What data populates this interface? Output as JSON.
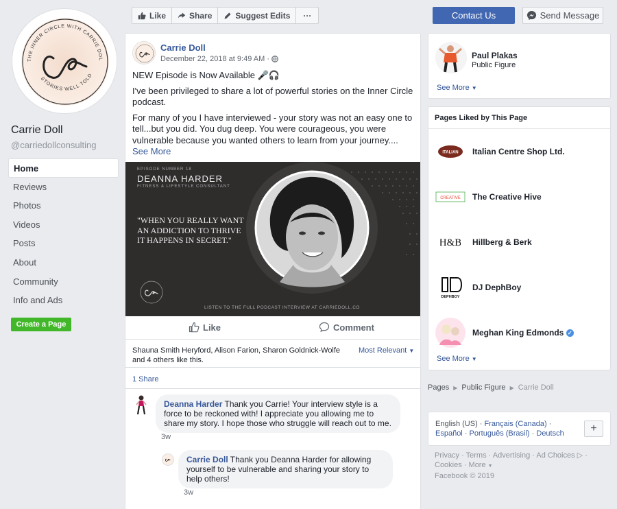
{
  "page": {
    "name": "Carrie Doll",
    "handle": "@carriedollconsulting",
    "logo_text": {
      "top_arc": "THE INNER CIRCLE WITH CARRIE DOLL",
      "bottom_arc": "STORIES WELL TOLD"
    }
  },
  "left_nav": {
    "items": [
      {
        "label": "Home",
        "active": true
      },
      {
        "label": "Reviews"
      },
      {
        "label": "Photos"
      },
      {
        "label": "Videos"
      },
      {
        "label": "Posts"
      },
      {
        "label": "About"
      },
      {
        "label": "Community"
      },
      {
        "label": "Info and Ads"
      }
    ],
    "create_page": "Create a Page"
  },
  "top_actions": {
    "like": "Like",
    "share": "Share",
    "suggest_edits": "Suggest Edits",
    "more": "···",
    "contact": "Contact Us",
    "send_message": "Send Message"
  },
  "post": {
    "author": "Carrie Doll",
    "date": "December 22, 2018 at 9:49 AM ·",
    "paragraphs": [
      "NEW Episode is Now Available 🎤🎧",
      "I've been privileged to share a lot of powerful stories on the Inner Circle podcast.",
      "For many of you I have interviewed - your story was not an easy one to tell...but you did. You dug deep. You were courageous, you were vulnerable because you wanted others to learn from your journey...."
    ],
    "see_more": "See More",
    "image": {
      "episode": "EPISODE NUMBER 18",
      "guest": "DEANNA HARDER",
      "guest_title": "FITNESS & LIFESTYLE CONSULTANT",
      "quote": "\"WHEN YOU REALLY WANT AN ADDICTION TO THRIVE IT HAPPENS IN SECRET.\"",
      "listen": "LISTEN TO THE FULL PODCAST INTERVIEW AT CARRIEDOLL.CO"
    },
    "like_label": "Like",
    "comment_label": "Comment",
    "likers": "Shauna Smith Heryford, Alison Farion, Sharon Goldnick-Wolfe and 4 others like this.",
    "sort": "Most Relevant",
    "shares": "1 Share",
    "comments": [
      {
        "author": "Deanna Harder",
        "text": " Thank you Carrie! Your interview style is a force to be reckoned with! I appreciate you allowing me to share my story. I hope those who struggle will reach out to me.",
        "time": "3w"
      },
      {
        "author": "Carrie Doll",
        "text": " Thank you Deanna Harder for allowing yourself to be vulnerable and sharing your story to help others!",
        "time": "3w"
      }
    ]
  },
  "right": {
    "featured": {
      "name": "Paul Plakas",
      "category": "Public Figure",
      "see_more": "See More"
    },
    "liked_pages": {
      "title": "Pages Liked by This Page",
      "items": [
        {
          "name": "Italian Centre Shop Ltd.",
          "logo": "ITALIAN"
        },
        {
          "name": "The Creative Hive",
          "logo": "CREATIVE"
        },
        {
          "name": "Hillberg & Berk",
          "logo": "H&B"
        },
        {
          "name": "DJ DephBoy",
          "logo": "DEPHBOY"
        },
        {
          "name": "Meghan King Edmonds",
          "verified": true
        }
      ],
      "see_more": "See More"
    },
    "breadcrumb": [
      "Pages",
      "Public Figure",
      "Carrie Doll"
    ],
    "languages": {
      "current": "English (US)",
      "others": [
        "Français (Canada)",
        "Español",
        "Português (Brasil)",
        "Deutsch"
      ]
    },
    "footer": {
      "links": [
        "Privacy",
        "Terms",
        "Advertising",
        "Ad Choices",
        "Cookies",
        "More"
      ],
      "copyright": "Facebook © 2019"
    }
  },
  "colors": {
    "fb_blue": "#4267b2",
    "link": "#365899",
    "green": "#42b72a",
    "bg": "#e9ebee"
  }
}
